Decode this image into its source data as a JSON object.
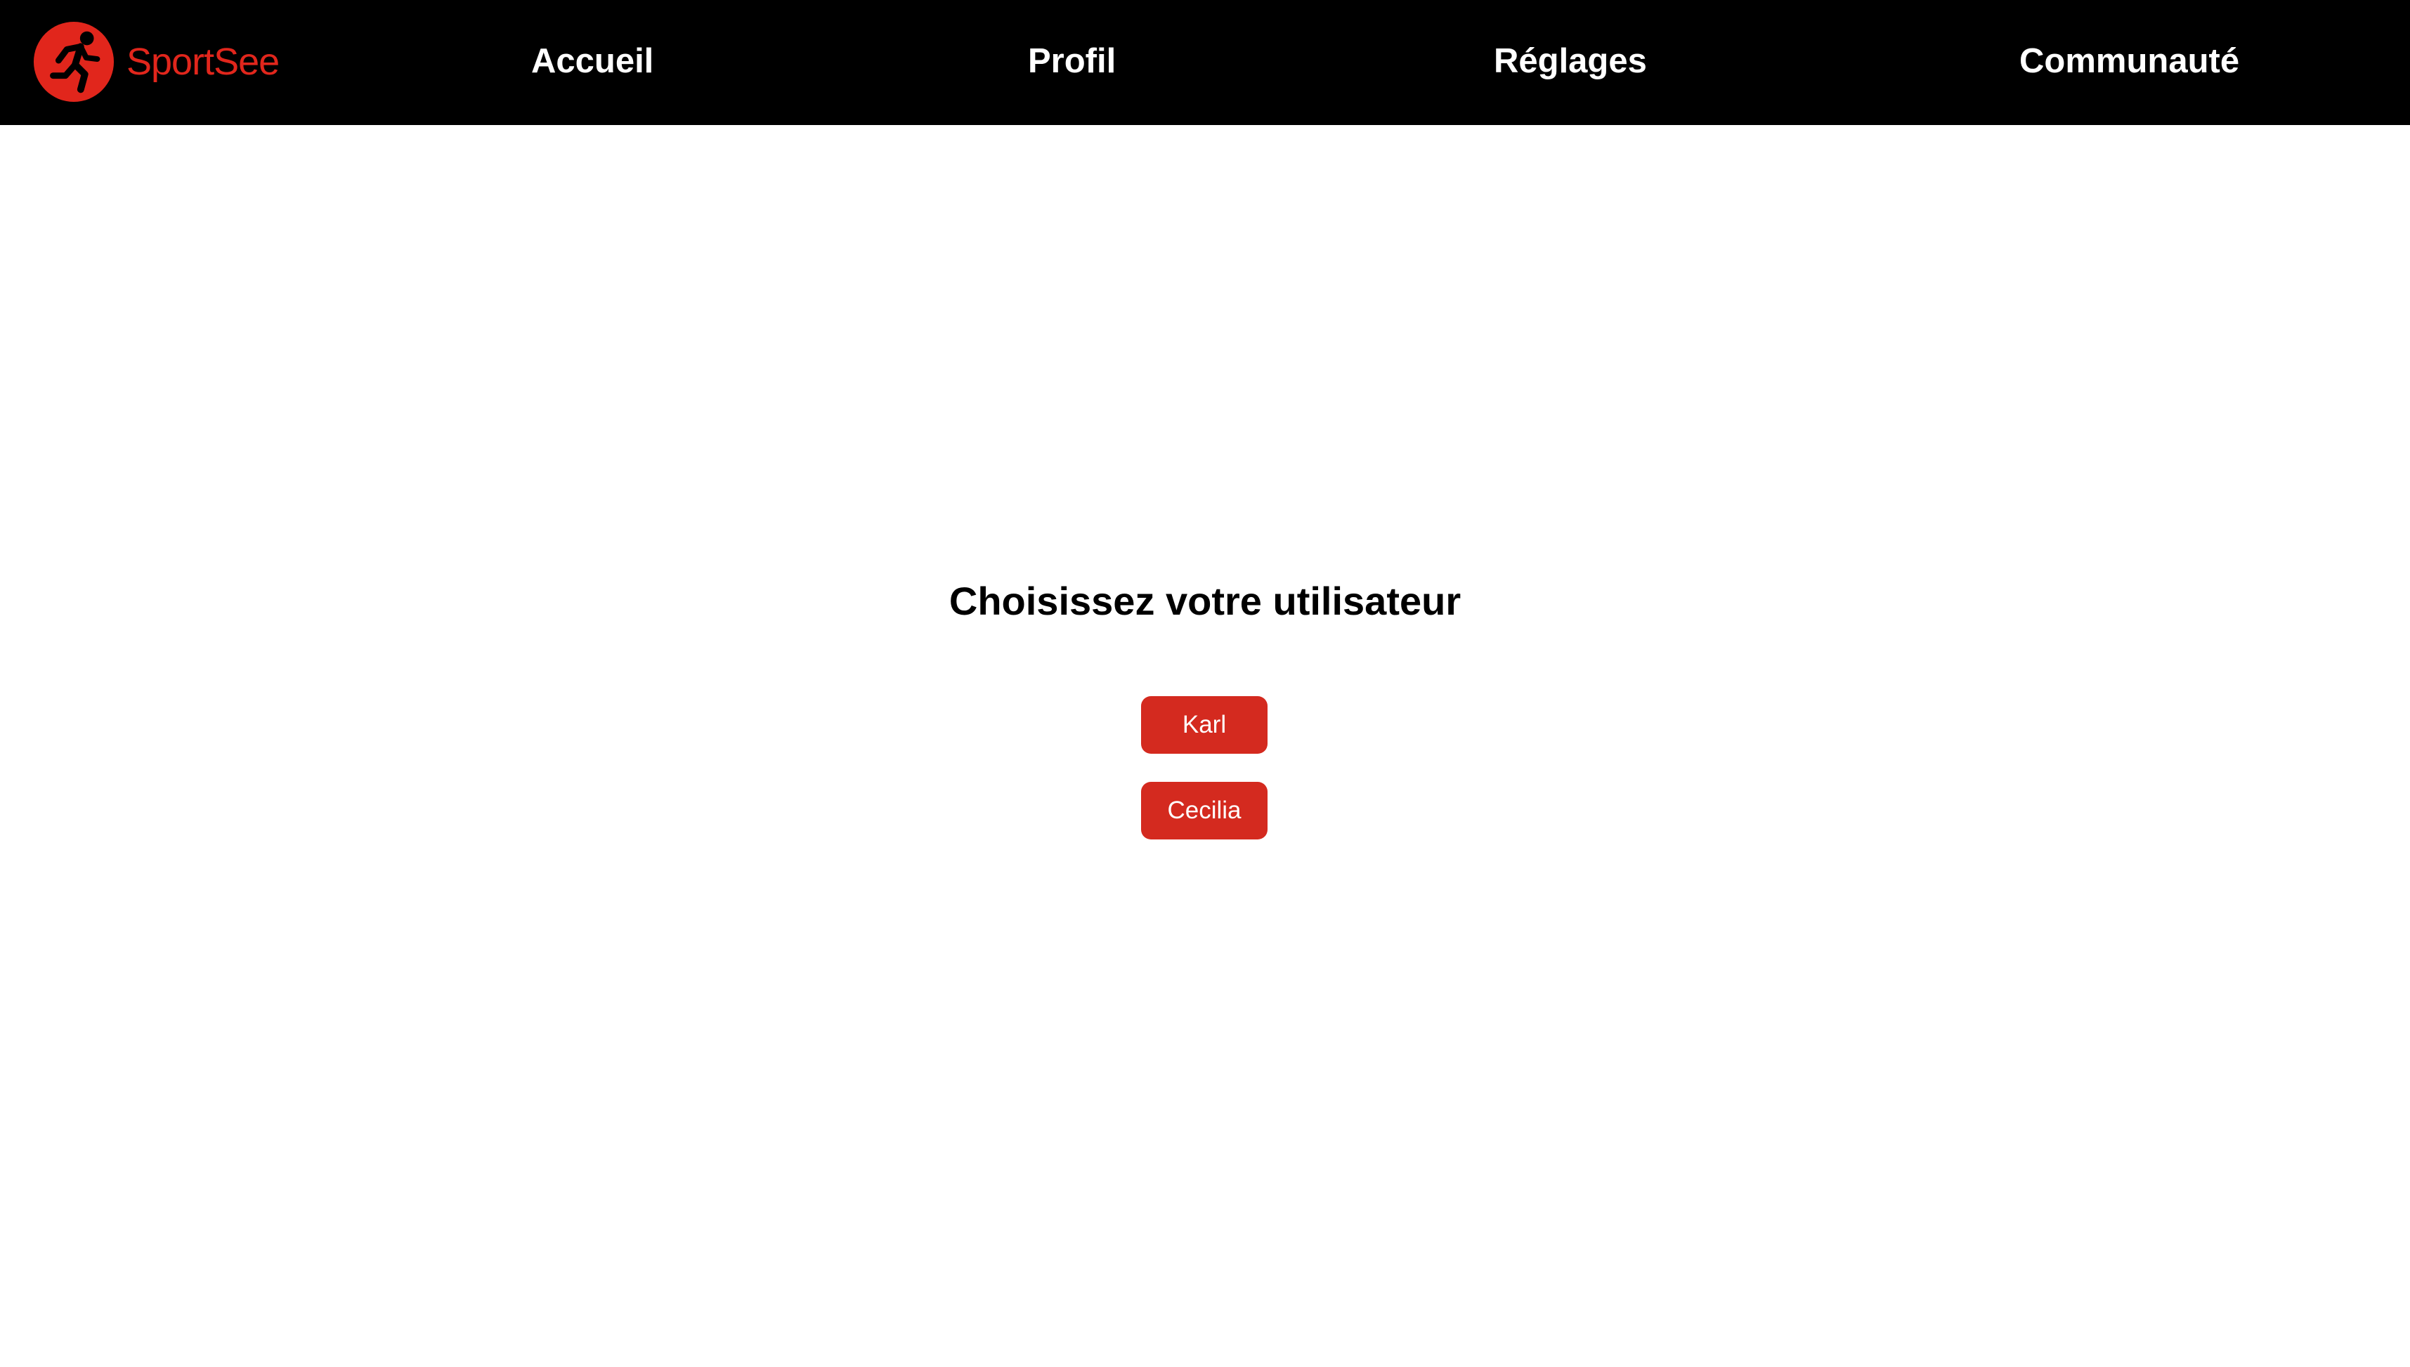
{
  "brand": {
    "name": "SportSee",
    "logo_icon": "runner-icon",
    "color": "#e1261c"
  },
  "nav": {
    "items": [
      {
        "label": "Accueil"
      },
      {
        "label": "Profil"
      },
      {
        "label": "Réglages"
      },
      {
        "label": "Communauté"
      }
    ]
  },
  "main": {
    "title": "Choisissez votre utilisateur",
    "users": [
      {
        "label": "Karl"
      },
      {
        "label": "Cecilia"
      }
    ],
    "button_color": "#d42a1f"
  }
}
